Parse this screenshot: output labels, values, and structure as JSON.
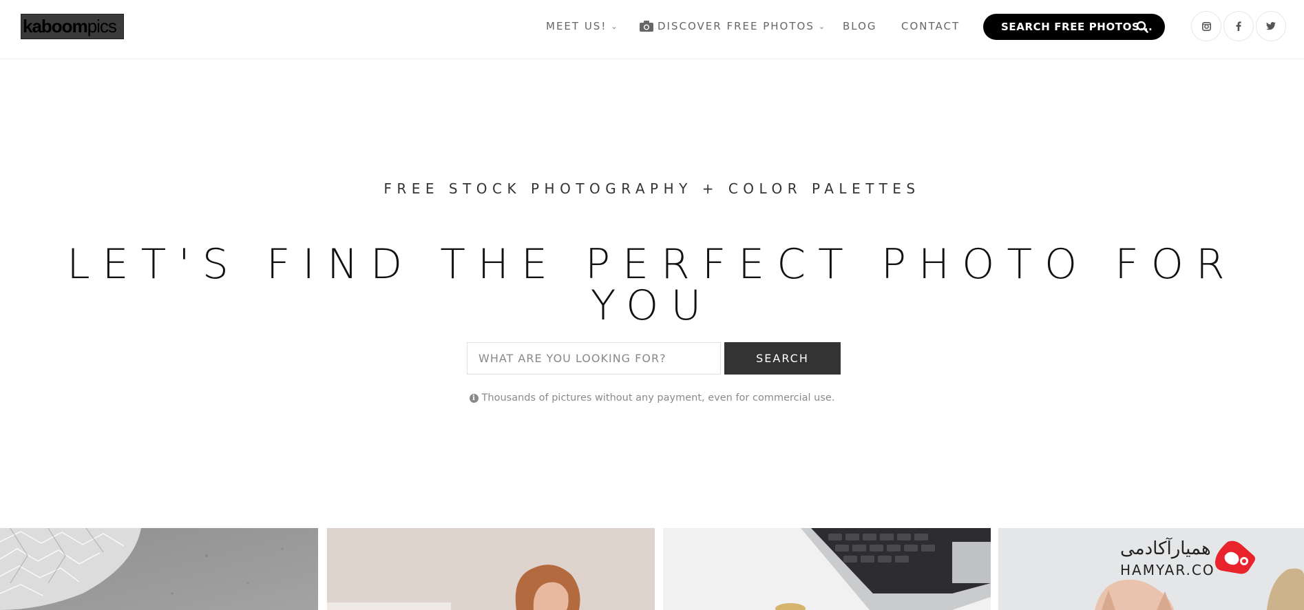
{
  "header": {
    "logo": {
      "bold": "kaboom",
      "light": "pics"
    },
    "nav": [
      {
        "label": "MEET US!",
        "has_dropdown": true
      },
      {
        "label": "DISCOVER FREE PHOTOS",
        "has_dropdown": true,
        "icon": "camera-icon"
      },
      {
        "label": "BLOG",
        "has_dropdown": false
      },
      {
        "label": "CONTACT",
        "has_dropdown": false
      }
    ],
    "search_pill_label": "SEARCH FREE PHOTOS...",
    "social": [
      {
        "icon": "instagram-icon",
        "glyph": "◘"
      },
      {
        "icon": "facebook-icon",
        "glyph": "f"
      },
      {
        "icon": "twitter-icon",
        "glyph": "🐦"
      }
    ]
  },
  "hero": {
    "tagline": "FREE STOCK PHOTOGRAPHY + COLOR PALETTES",
    "headline": "LET'S FIND THE PERFECT PHOTO FOR YOU",
    "search": {
      "placeholder": "WHAT ARE YOU LOOKING FOR?",
      "value": "",
      "button_label": "SEARCH"
    },
    "note": "Thousands of pictures without any payment, even for commercial use."
  },
  "gallery": [
    {
      "subject": "crystal-bowl-on-concrete"
    },
    {
      "subject": "woman-red-hair"
    },
    {
      "subject": "laptop-on-desk"
    },
    {
      "subject": "woman-hands-face"
    }
  ],
  "watermark": {
    "fa": "همیارآکادمی",
    "en": "HAMYAR.CO"
  },
  "colors": {
    "accent_dark": "#333333",
    "pill_black": "#000000",
    "nav_text": "#666666",
    "watermark_red": "#e8232b"
  }
}
